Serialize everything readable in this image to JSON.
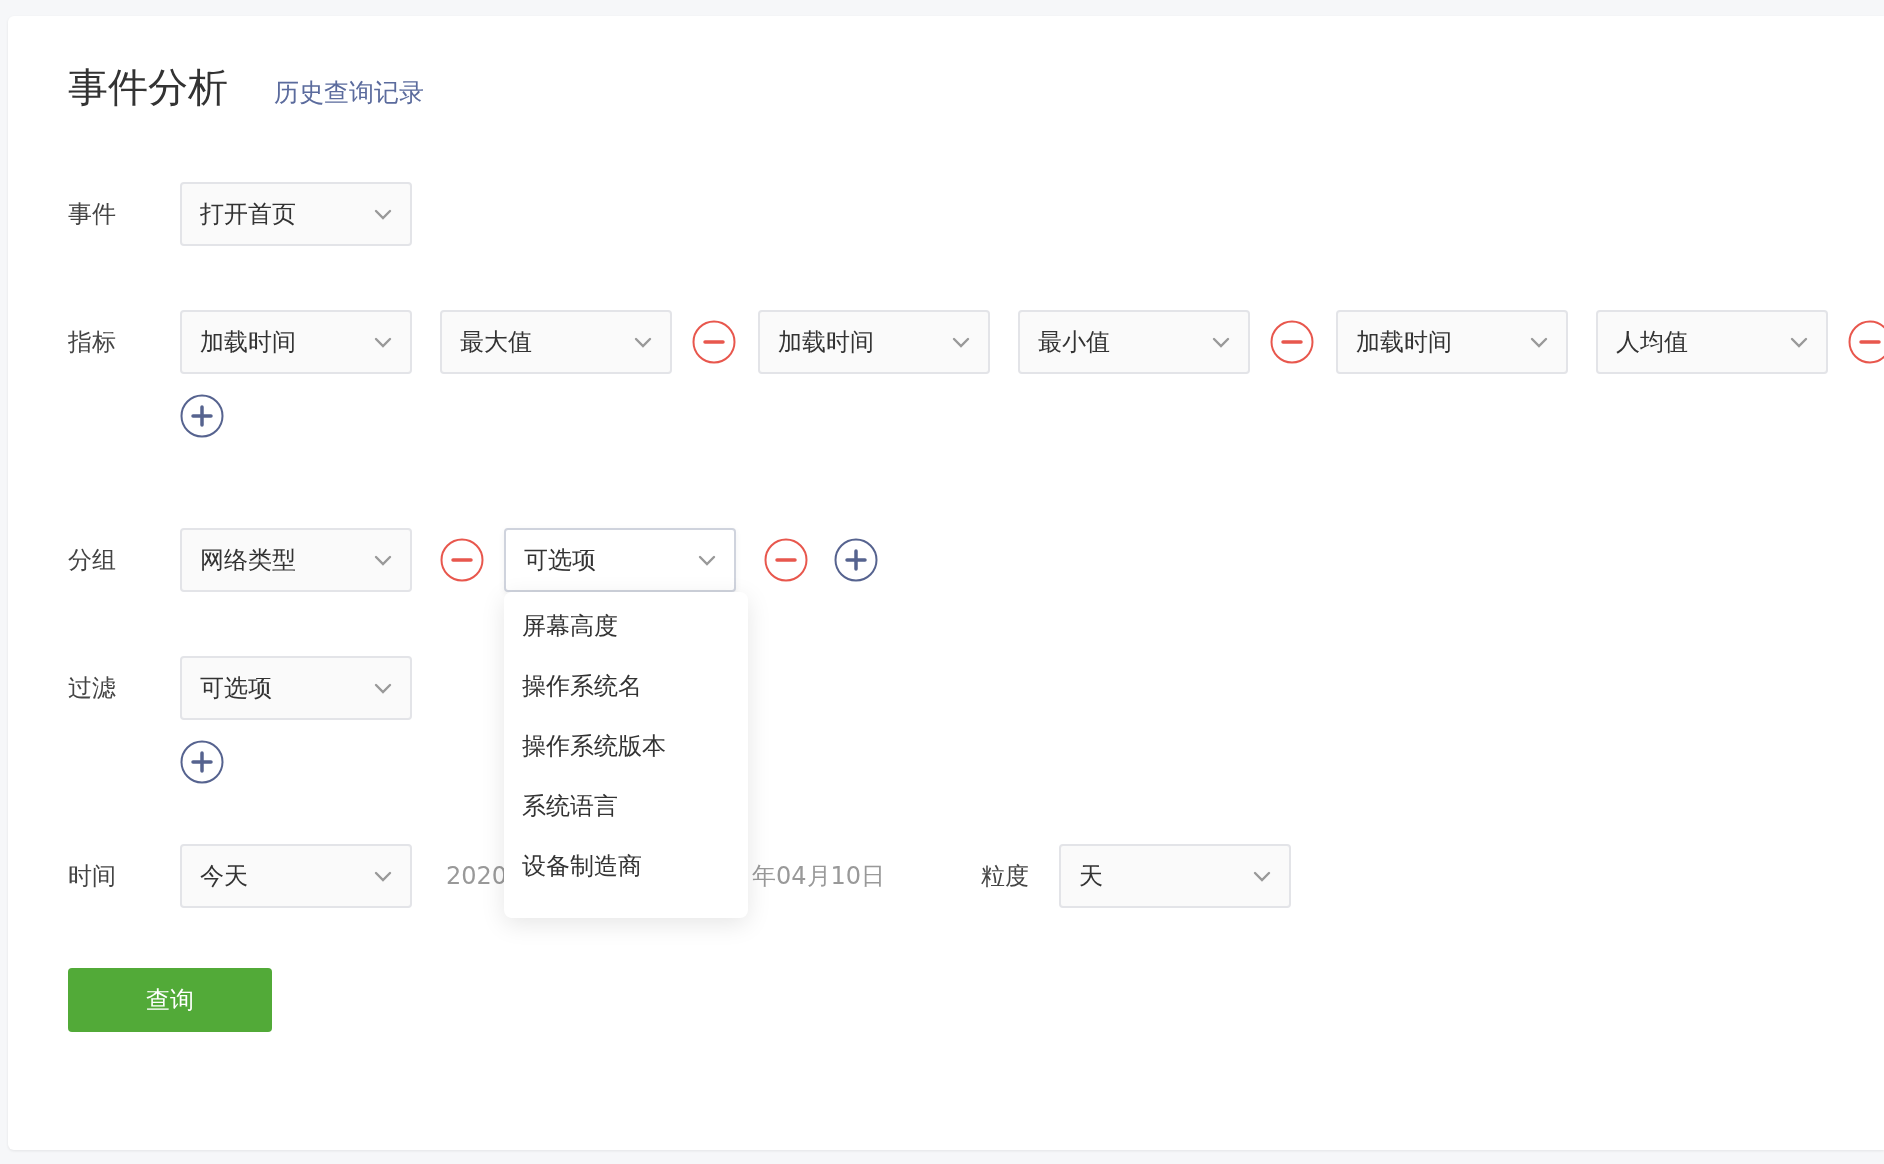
{
  "title": "事件分析",
  "history_link": "历史查询记录",
  "event": {
    "label": "事件",
    "value": "打开首页"
  },
  "metrics": {
    "label": "指标",
    "items": [
      {
        "field": "加载时间",
        "aggregate": "最大值"
      },
      {
        "field": "加载时间",
        "aggregate": "最小值"
      },
      {
        "field": "加载时间",
        "aggregate": "人均值"
      }
    ]
  },
  "group": {
    "label": "分组",
    "selects": [
      {
        "value": "网络类型",
        "expanded": false
      },
      {
        "value": "可选项",
        "expanded": true,
        "options": [
          "屏幕高度",
          "操作系统名",
          "操作系统版本",
          "系统语言",
          "设备制造商"
        ]
      }
    ]
  },
  "filter": {
    "label": "过滤",
    "value": "可选项"
  },
  "time": {
    "label": "时间",
    "value": "今天",
    "date_visible_start": "2020",
    "date_visible_end": "年04月10日",
    "granularity_label": "粒度",
    "granularity": "天"
  },
  "query_button": "查询"
}
